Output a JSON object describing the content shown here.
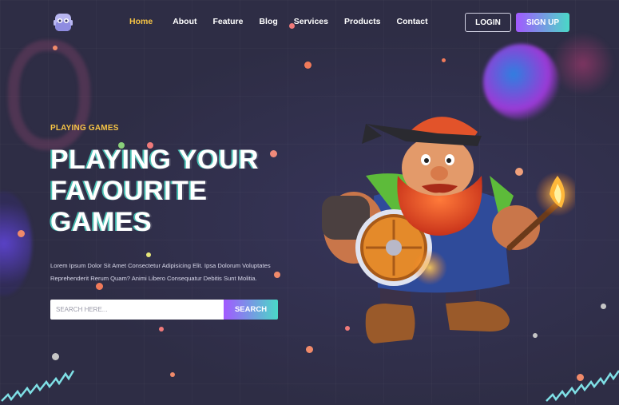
{
  "header": {
    "logo_icon": "gamepad-robot-icon",
    "nav": [
      {
        "label": "Home",
        "active": true
      },
      {
        "label": "About",
        "active": false
      },
      {
        "label": "Feature",
        "active": false
      },
      {
        "label": "Blog",
        "active": false
      },
      {
        "label": "Services",
        "active": false
      },
      {
        "label": "Products",
        "active": false
      },
      {
        "label": "Contact",
        "active": false
      }
    ],
    "login_label": "LOGIN",
    "signup_label": "SIGN UP"
  },
  "hero": {
    "eyebrow": "PLAYING GAMES",
    "title_lines": [
      "PLAYING YOUR",
      "FAVOURITE",
      "GAMES"
    ],
    "description_lines": [
      "Lorem Ipsum Dolor Sit Amet Consectetur Adipisicing Elit. Ipsa Dolorum Voluptates",
      "Reprehenderit Rerum Quam? Animi Libero Consequatur Debitis Sunt Molitia."
    ],
    "search_placeholder": "SEARCH HERE...",
    "search_button": "SEARCH"
  },
  "illustration": {
    "subject": "bearded-dwarf-warrior-with-shield-and-torch"
  },
  "colors": {
    "background": "#2e2d45",
    "accent_yellow": "#f6c445",
    "gradient_start": "#a259ff",
    "gradient_end": "#4ad9c7"
  }
}
